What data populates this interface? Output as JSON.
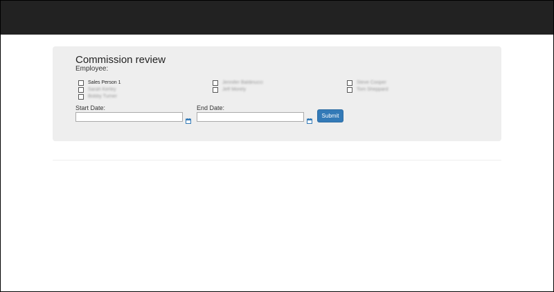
{
  "page": {
    "title": "Commission review",
    "employee_label": "Employee:"
  },
  "employees": [
    {
      "label": "Sales Person 1",
      "checked": false
    },
    {
      "label": "Jennifer Baldinucci",
      "checked": false
    },
    {
      "label": "Steve Cooper",
      "checked": false
    },
    {
      "label": "Sarah Kerley",
      "checked": false
    },
    {
      "label": "Jeff Morely",
      "checked": false
    },
    {
      "label": "Tom Sheppard",
      "checked": false
    },
    {
      "label": "Bobby Turner",
      "checked": false
    }
  ],
  "form": {
    "start_date_label": "Start Date:",
    "start_date_value": "",
    "end_date_label": "End Date:",
    "end_date_value": "",
    "submit_label": "Submit"
  },
  "icons": {
    "calendar": "calendar-icon"
  },
  "colors": {
    "navbar": "#222222",
    "panel": "#eeeeee",
    "primary_button": "#337ab7",
    "calendar_icon": "#337ab7"
  }
}
